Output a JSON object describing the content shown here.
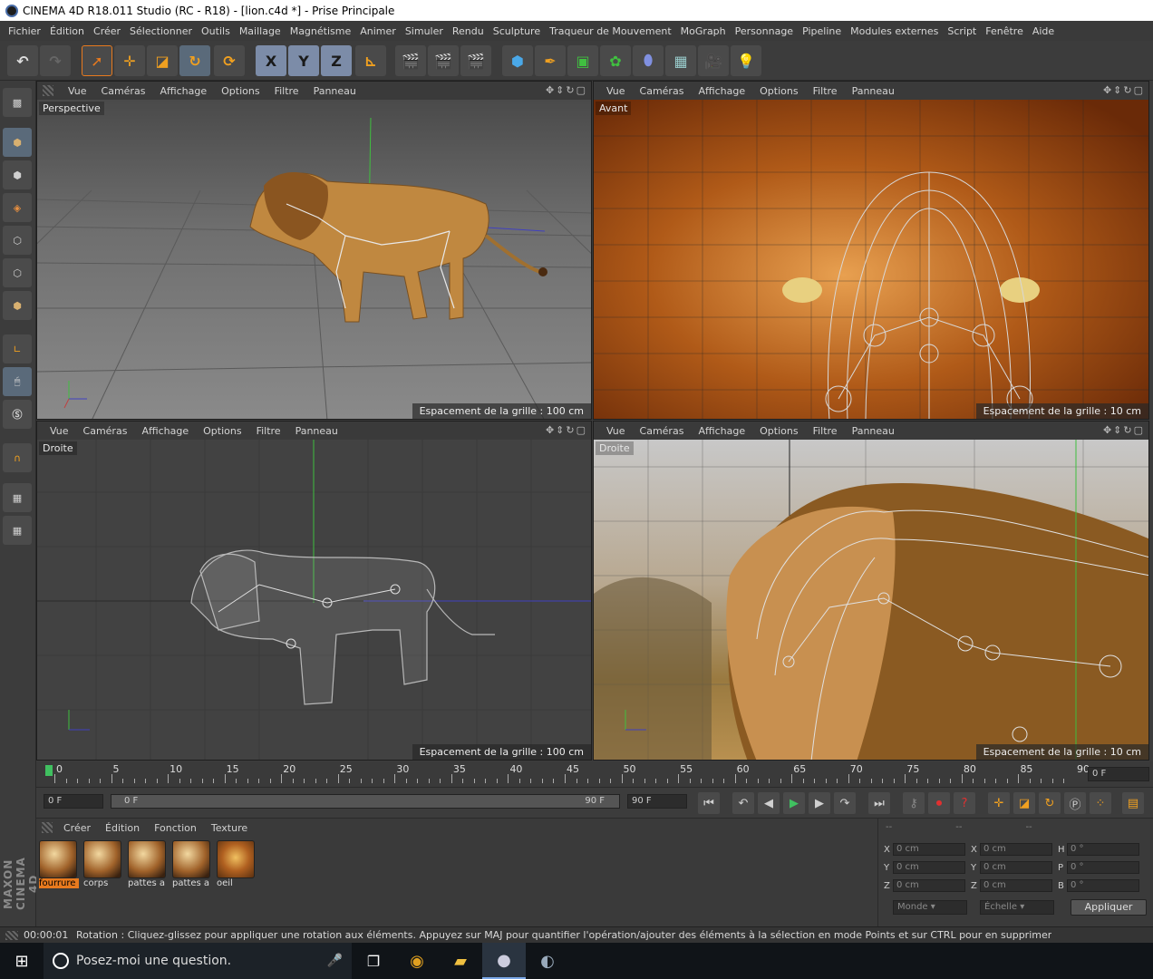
{
  "window": {
    "title": "CINEMA 4D R18.011 Studio (RC - R18) - [lion.c4d *] - Prise Principale"
  },
  "menu": [
    "Fichier",
    "Édition",
    "Créer",
    "Sélectionner",
    "Outils",
    "Maillage",
    "Magnétisme",
    "Animer",
    "Simuler",
    "Rendu",
    "Sculpture",
    "Traqueur de Mouvement",
    "MoGraph",
    "Personnage",
    "Pipeline",
    "Modules externes",
    "Script",
    "Fenêtre",
    "Aide"
  ],
  "toolbar": {
    "x_label": "X",
    "y_label": "Y",
    "z_label": "Z"
  },
  "viewport_menu": [
    "Vue",
    "Caméras",
    "Affichage",
    "Options",
    "Filtre",
    "Panneau"
  ],
  "viewports": [
    {
      "label": "Perspective",
      "grid": "Espacement de la grille : 100 cm"
    },
    {
      "label": "Avant",
      "grid": "Espacement de la grille : 10 cm"
    },
    {
      "label": "Droite",
      "grid": "Espacement de la grille : 100 cm"
    },
    {
      "label": "Droite",
      "grid": "Espacement de la grille : 10 cm"
    }
  ],
  "timeline": {
    "ticks": [
      "0",
      "5",
      "10",
      "15",
      "20",
      "25",
      "30",
      "35",
      "40",
      "45",
      "50",
      "55",
      "60",
      "65",
      "70",
      "75",
      "80",
      "85",
      "90"
    ],
    "frame_end_field": "0 F"
  },
  "playback": {
    "current": "0 F",
    "range_start": "0 F",
    "range_end": "90 F",
    "max": "90 F"
  },
  "materials": {
    "menu": [
      "Créer",
      "Édition",
      "Fonction",
      "Texture"
    ],
    "items": [
      "fourrure",
      "corps",
      "pattes a",
      "pattes a",
      "oeil"
    ]
  },
  "coords": {
    "rows": [
      {
        "a": "X",
        "av": "0 cm",
        "b": "X",
        "bv": "0 cm",
        "c": "H",
        "cv": "0 °"
      },
      {
        "a": "Y",
        "av": "0 cm",
        "b": "Y",
        "bv": "0 cm",
        "c": "P",
        "cv": "0 °"
      },
      {
        "a": "Z",
        "av": "0 cm",
        "b": "Z",
        "bv": "0 cm",
        "c": "B",
        "cv": "0 °"
      }
    ],
    "header": [
      "--",
      "--",
      "--"
    ],
    "mode1": "Monde",
    "mode2": "Échelle",
    "apply": "Appliquer"
  },
  "status": {
    "time": "00:00:01",
    "text": "Rotation : Cliquez-glissez pour appliquer une rotation aux éléments. Appuyez sur MAJ pour quantifier l'opération/ajouter des éléments à la sélection en mode Points et sur CTRL pour en supprimer"
  },
  "brand": {
    "line1": "MAXON",
    "line2": "CINEMA 4D"
  },
  "taskbar": {
    "search": "Posez-moi une question."
  },
  "colors": {
    "accent": "#e87a1e",
    "ui_bg": "#3c3c3c",
    "y_axis": "#3fbf3f",
    "x_axis": "#3f3fd0"
  }
}
